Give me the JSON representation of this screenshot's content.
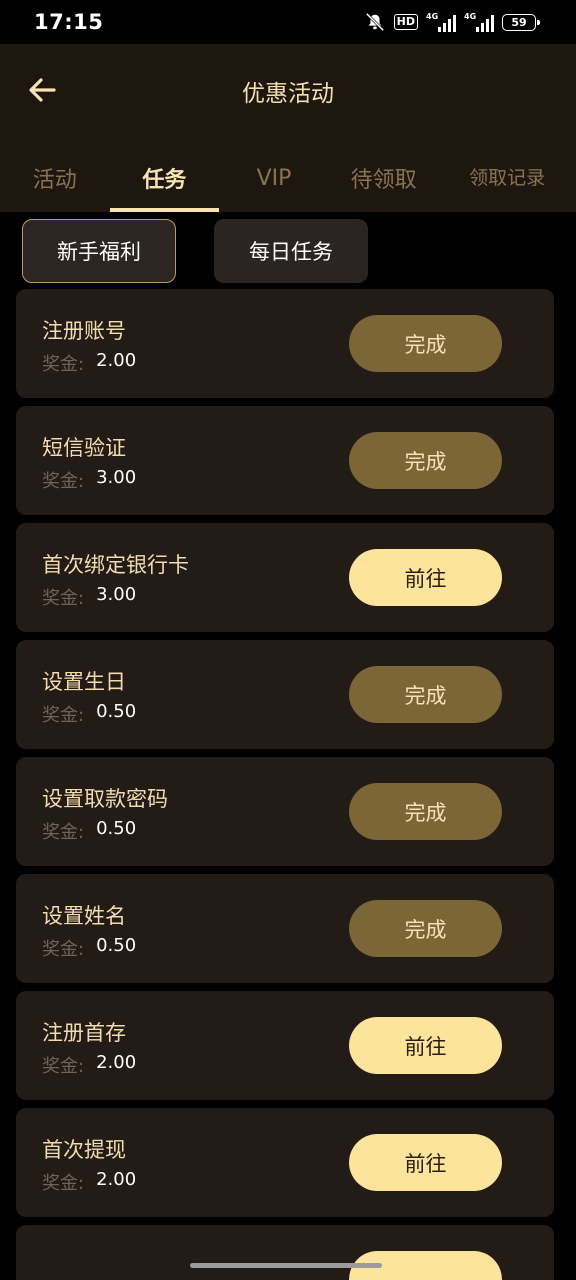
{
  "status_bar": {
    "time": "17:15",
    "hd_label": "HD",
    "signal1_label": "4G",
    "signal2_label": "4G",
    "battery": "59"
  },
  "header": {
    "title": "优惠活动",
    "back_icon": "arrow-left-icon"
  },
  "tabs": [
    {
      "label": "活动",
      "active": false
    },
    {
      "label": "任务",
      "active": true
    },
    {
      "label": "VIP",
      "active": false
    },
    {
      "label": "待领取",
      "active": false
    },
    {
      "label": "领取记录",
      "active": false
    }
  ],
  "subtabs": [
    {
      "label": "新手福利",
      "active": true
    },
    {
      "label": "每日任务",
      "active": false
    }
  ],
  "reward_label": "奖金:",
  "tasks": [
    {
      "name": "注册账号",
      "reward": "2.00",
      "action": "完成",
      "state": "done"
    },
    {
      "name": "短信验证",
      "reward": "3.00",
      "action": "完成",
      "state": "done"
    },
    {
      "name": "首次绑定银行卡",
      "reward": "3.00",
      "action": "前往",
      "state": "go"
    },
    {
      "name": "设置生日",
      "reward": "0.50",
      "action": "完成",
      "state": "done"
    },
    {
      "name": "设置取款密码",
      "reward": "0.50",
      "action": "完成",
      "state": "done"
    },
    {
      "name": "设置姓名",
      "reward": "0.50",
      "action": "完成",
      "state": "done"
    },
    {
      "name": "注册首存",
      "reward": "2.00",
      "action": "前往",
      "state": "go"
    },
    {
      "name": "首次提现",
      "reward": "2.00",
      "action": "前往",
      "state": "go"
    },
    {
      "name": "",
      "reward": "",
      "action": "",
      "state": "go"
    }
  ],
  "colors": {
    "accent_gold": "#fde49c",
    "done_button": "#7b6638",
    "card_bg": "#231b15",
    "header_bg": "#1e1710"
  }
}
